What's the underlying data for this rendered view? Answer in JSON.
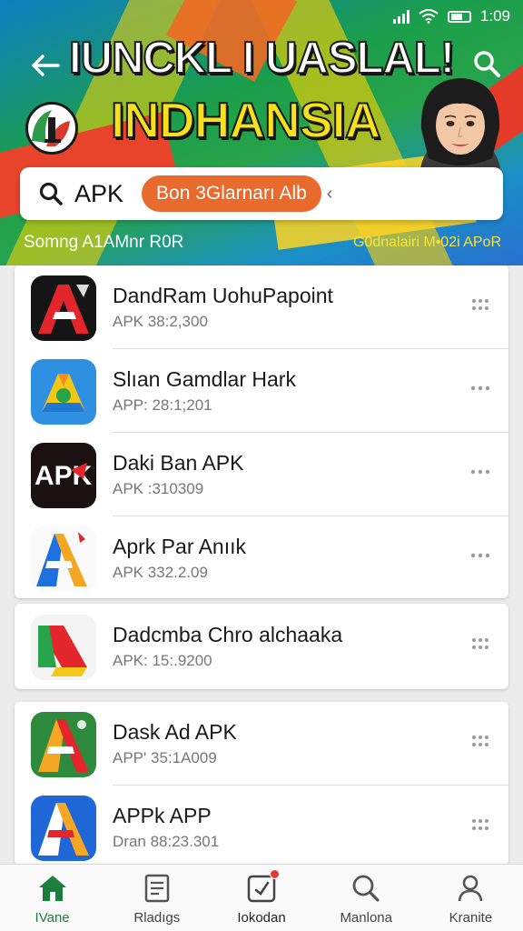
{
  "status_bar": {
    "time": "1:09"
  },
  "header": {
    "title_line1": "IUNCKL I UASLAL!",
    "title_line2": "INDHANSIA",
    "subtitle_left": "Somng A1AMnr R0R",
    "subtitle_right": "G0dnalairi M•02i APoR"
  },
  "search": {
    "value": "APK",
    "button_label": "Bon 3Glarnarı Alb"
  },
  "apps": [
    {
      "name": "DandRam UohuPapoint",
      "meta": "APK 38:2,300",
      "icon": "red-a-icon"
    },
    {
      "name": "Slıan Gamdlar Hark",
      "meta": "APP: 28:1;201",
      "icon": "triangle-drive-icon"
    },
    {
      "name": "Daki Ban APK",
      "meta": "APK :310309",
      "icon": "apk-dark-icon"
    },
    {
      "name": "Aprk Par Anıık",
      "meta": "APK 332.2.09",
      "icon": "blue-a-icon"
    },
    {
      "name": "Dadcmba Chro alchaaka",
      "meta": "APK: 15:.9200",
      "icon": "drive-color-icon"
    },
    {
      "name": "Dask Ad APK",
      "meta": "APP' 35:1A009",
      "icon": "green-a-icon"
    },
    {
      "name": "APPk APP",
      "meta": "Dran 88:23.301",
      "icon": "blue-a2-icon"
    }
  ],
  "nav": [
    {
      "label": "IVane",
      "icon": "home-icon",
      "active": true
    },
    {
      "label": "Rladıgs",
      "icon": "document-icon",
      "active": false
    },
    {
      "label": "Iokodan",
      "icon": "download-icon",
      "active": false
    },
    {
      "label": "Manlona",
      "icon": "search-icon",
      "active": false
    },
    {
      "label": "Kranite",
      "icon": "person-icon",
      "active": false
    }
  ],
  "colors": {
    "accent_green": "#1b7e3c",
    "pill_orange": "#e86a2d",
    "title_yellow": "#f7e11c",
    "badge_red": "#e53935"
  }
}
